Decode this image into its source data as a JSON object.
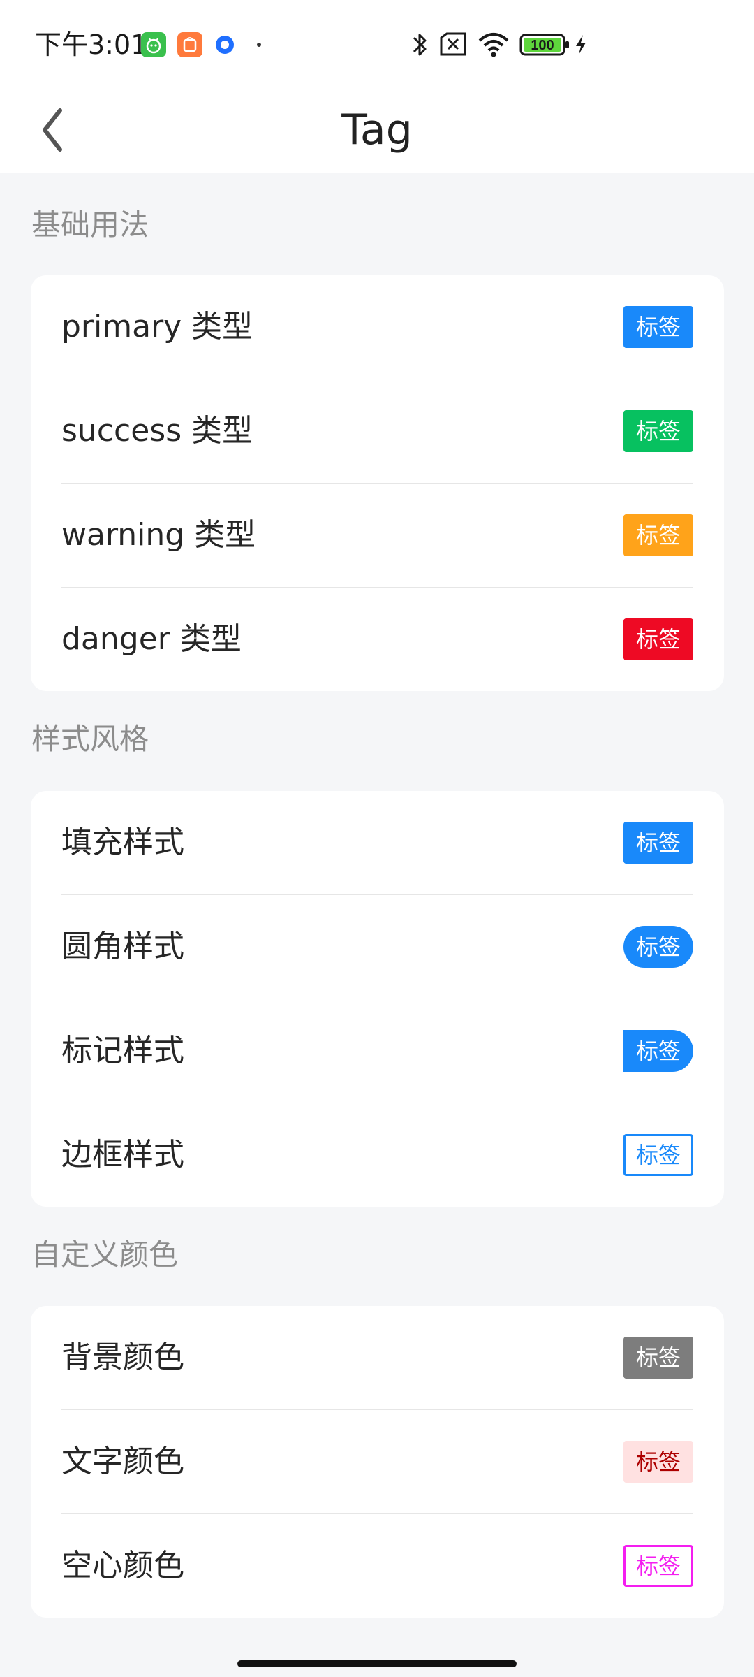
{
  "status_bar": {
    "time": "下午3:01",
    "battery": "100"
  },
  "nav": {
    "title": "Tag"
  },
  "sections": [
    {
      "title": "基础用法",
      "rows": [
        {
          "label": "primary 类型",
          "tag": "标签",
          "style": "primary"
        },
        {
          "label": "success 类型",
          "tag": "标签",
          "style": "success"
        },
        {
          "label": "warning 类型",
          "tag": "标签",
          "style": "warning"
        },
        {
          "label": "danger 类型",
          "tag": "标签",
          "style": "danger"
        }
      ]
    },
    {
      "title": "样式风格",
      "rows": [
        {
          "label": "填充样式",
          "tag": "标签",
          "style": "fill"
        },
        {
          "label": "圆角样式",
          "tag": "标签",
          "style": "round"
        },
        {
          "label": "标记样式",
          "tag": "标签",
          "style": "mark"
        },
        {
          "label": "边框样式",
          "tag": "标签",
          "style": "plain"
        }
      ]
    },
    {
      "title": "自定义颜色",
      "rows": [
        {
          "label": "背景颜色",
          "tag": "标签",
          "style": "custom-bg"
        },
        {
          "label": "文字颜色",
          "tag": "标签",
          "style": "custom-text"
        },
        {
          "label": "空心颜色",
          "tag": "标签",
          "style": "custom-plain"
        }
      ]
    }
  ],
  "colors": {
    "primary": "#1989fa",
    "success": "#07c160",
    "warning": "#ff976a",
    "danger": "#ee0a24",
    "custom_bg": "#7d7d7d",
    "custom_text_bg": "#ffe1e1",
    "custom_text_color": "#ad0000",
    "custom_plain": "#f41ef0"
  },
  "icons": {
    "back": "chevron-left-icon",
    "bluetooth": "bluetooth-icon",
    "sim": "no-sim-icon",
    "wifi": "wifi-icon",
    "battery": "battery-icon",
    "charging": "charging-bolt-icon"
  }
}
